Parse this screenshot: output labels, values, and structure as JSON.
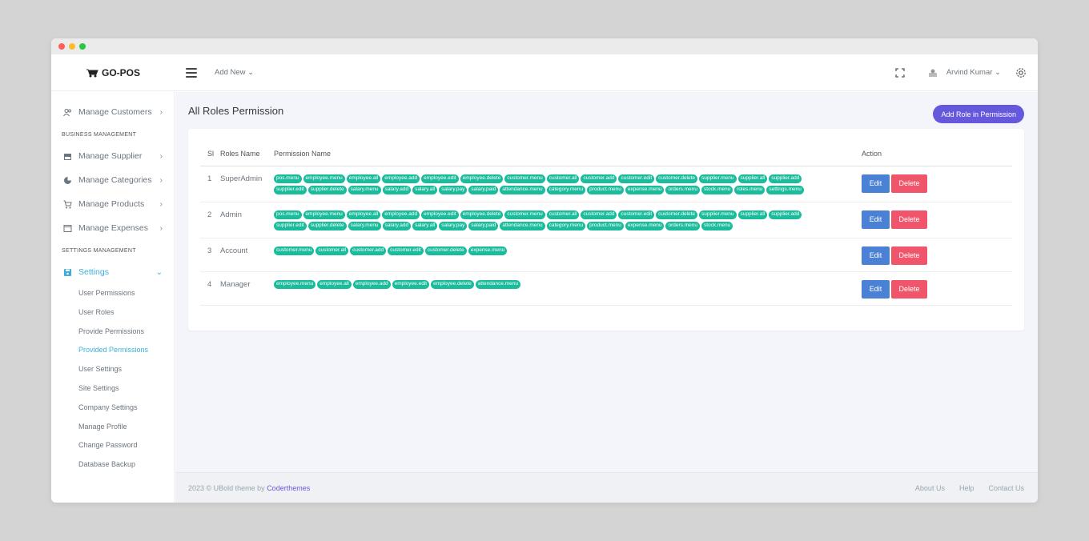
{
  "brand": {
    "name": "GO-POS"
  },
  "topbar": {
    "add_new": "Add New ⌄",
    "user_name": "Arvind Kumar ⌄"
  },
  "sidebar": {
    "manage_customers": "Manage Customers",
    "section_business": "BUSINESS MANAGEMENT",
    "manage_supplier": "Manage Supplier",
    "manage_categories": "Manage Categories",
    "manage_products": "Manage Products",
    "manage_expenses": "Manage Expenses",
    "section_settings": "SETTINGS MANAGEMENT",
    "settings": "Settings",
    "sub_items": [
      "User Permissions",
      "User Roles",
      "Provide Permissions",
      "Provided Permissions",
      "User Settings",
      "Site Settings",
      "Company Settings",
      "Manage Profile",
      "Change Password",
      "Database Backup"
    ]
  },
  "page": {
    "title": "All Roles Permission",
    "add_button": "Add Role in Permission"
  },
  "table": {
    "headers": {
      "sl": "Sl",
      "role": "Roles Name",
      "perm": "Permission Name",
      "action": "Action"
    },
    "edit_label": "Edit",
    "delete_label": "Delete",
    "rows": [
      {
        "sl": "1",
        "role": "SuperAdmin",
        "perms": [
          "pos.menu",
          "employee.menu",
          "employee.all",
          "employee.add",
          "employee.edit",
          "employee.delete",
          "customer.menu",
          "customer.all",
          "customer.add",
          "customer.edit",
          "customer.delete",
          "supplier.menu",
          "supplier.all",
          "supplier.add",
          "supplier.edit",
          "supplier.delete",
          "salary.menu",
          "salary.add",
          "salary.all",
          "salary.pay",
          "salary.paid",
          "attendance.menu",
          "category.menu",
          "product.menu",
          "expense.menu",
          "orders.menu",
          "stock.menu",
          "roles.menu",
          "settings.menu"
        ]
      },
      {
        "sl": "2",
        "role": "Admin",
        "perms": [
          "pos.menu",
          "employee.menu",
          "employee.all",
          "employee.add",
          "employee.edit",
          "employee.delete",
          "customer.menu",
          "customer.all",
          "customer.add",
          "customer.edit",
          "customer.delete",
          "supplier.menu",
          "supplier.all",
          "supplier.add",
          "supplier.edit",
          "supplier.delete",
          "salary.menu",
          "salary.add",
          "salary.all",
          "salary.pay",
          "salary.paid",
          "attendance.menu",
          "category.menu",
          "product.menu",
          "expense.menu",
          "orders.menu",
          "stock.menu"
        ]
      },
      {
        "sl": "3",
        "role": "Account",
        "perms": [
          "customer.menu",
          "customer.all",
          "customer.add",
          "customer.edit",
          "customer.delete",
          "expense.menu"
        ]
      },
      {
        "sl": "4",
        "role": "Manager",
        "perms": [
          "employee.menu",
          "employee.all",
          "employee.add",
          "employee.edit",
          "employee.delete",
          "attendance.menu"
        ]
      }
    ]
  },
  "footer": {
    "copyright": "2023 © UBold theme by ",
    "brand_link": "Coderthemes",
    "links": [
      "About Us",
      "Help",
      "Contact Us"
    ]
  },
  "colors": {
    "primary": "#6658dd",
    "success": "#1abc9c",
    "info": "#3bafda",
    "edit": "#4a81d4",
    "danger": "#f1556c"
  }
}
